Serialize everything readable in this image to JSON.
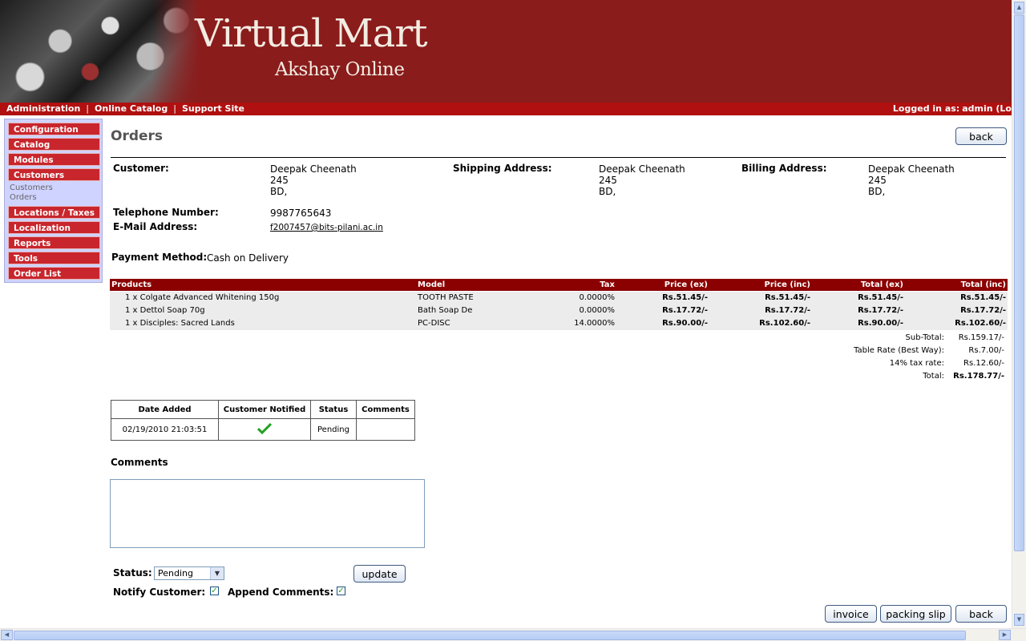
{
  "header": {
    "title": "Virtual Mart",
    "subtitle": "Akshay Online"
  },
  "topnav": {
    "links": [
      "Administration",
      "Online Catalog",
      "Support Site"
    ],
    "login_text": "Logged in as:",
    "login_user": "admin (Lo"
  },
  "sidebar": {
    "items": [
      "Configuration",
      "Catalog",
      "Modules",
      "Customers",
      "Locations / Taxes",
      "Localization",
      "Reports",
      "Tools",
      "Order List"
    ],
    "subitems": [
      "Customers",
      "Orders"
    ]
  },
  "page": {
    "title": "Orders",
    "back_label": "back"
  },
  "customer": {
    "customer_label": "Customer:",
    "shipping_label": "Shipping Address:",
    "billing_label": "Billing Address:",
    "customer_address": [
      "Deepak Cheenath",
      "245",
      "BD,"
    ],
    "shipping_address": [
      "Deepak Cheenath",
      "245",
      "BD,"
    ],
    "billing_address": [
      "Deepak Cheenath",
      "245",
      "BD,"
    ],
    "telephone_label": "Telephone Number:",
    "telephone": "9987765643",
    "email_label": "E-Mail Address:",
    "email": "f2007457@bits-pilani.ac.in",
    "payment_label": "Payment Method:",
    "payment": "Cash on Delivery"
  },
  "products": {
    "headers": [
      "Products",
      "Model",
      "Tax",
      "Price (ex)",
      "Price (inc)",
      "Total (ex)",
      "Total (inc)"
    ],
    "rows": [
      {
        "product": "1 x Colgate Advanced Whitening 150g",
        "model": "TOOTH PASTE",
        "tax": "0.0000%",
        "price_ex": "Rs.51.45/-",
        "price_inc": "Rs.51.45/-",
        "total_ex": "Rs.51.45/-",
        "total_inc": "Rs.51.45/-"
      },
      {
        "product": "1 x Dettol Soap 70g",
        "model": "Bath Soap De",
        "tax": "0.0000%",
        "price_ex": "Rs.17.72/-",
        "price_inc": "Rs.17.72/-",
        "total_ex": "Rs.17.72/-",
        "total_inc": "Rs.17.72/-"
      },
      {
        "product": "1 x Disciples: Sacred Lands",
        "model": "PC-DISC",
        "tax": "14.0000%",
        "price_ex": "Rs.90.00/-",
        "price_inc": "Rs.102.60/-",
        "total_ex": "Rs.90.00/-",
        "total_inc": "Rs.102.60/-"
      }
    ]
  },
  "totals": [
    {
      "label": "Sub-Total:",
      "value": "Rs.159.17/-"
    },
    {
      "label": "Table Rate (Best Way):",
      "value": "Rs.7.00/-"
    },
    {
      "label": "14% tax rate:",
      "value": "Rs.12.60/-"
    },
    {
      "label": "Total:",
      "value": "Rs.178.77/-"
    }
  ],
  "history": {
    "headers": [
      "Date Added",
      "Customer Notified",
      "Status",
      "Comments"
    ],
    "row": {
      "date": "02/19/2010 21:03:51",
      "notified_icon": "check-icon",
      "status": "Pending",
      "comments": ""
    }
  },
  "form": {
    "comments_label": "Comments",
    "comments_value": "",
    "status_label": "Status:",
    "status_value": "Pending",
    "update_label": "update",
    "notify_label": "Notify Customer:",
    "notify_checked": true,
    "append_label": "Append Comments:",
    "append_checked": true
  },
  "footer_buttons": {
    "invoice": "invoice",
    "packing_slip": "packing slip",
    "back": "back"
  },
  "colors": {
    "banner": "#8a1c1c",
    "nav_bar": "#b01010",
    "sidebar_button": "#c8262c",
    "table_header": "#8b0000",
    "check": "#21a121"
  }
}
